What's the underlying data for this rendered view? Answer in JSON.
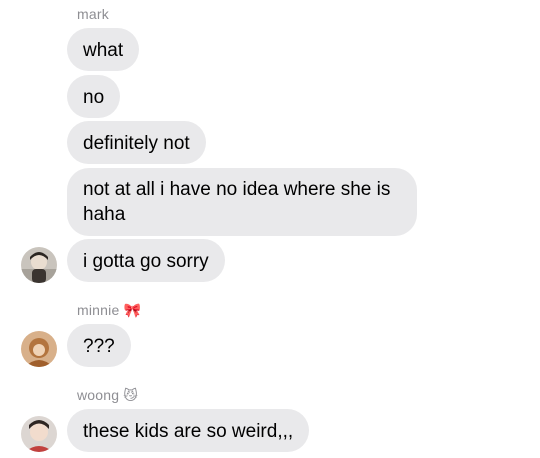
{
  "groups": [
    {
      "sender": "mark",
      "sender_emoji": "",
      "messages": [
        "what",
        "no",
        "definitely not",
        "not at all i have no idea where she is haha",
        "i gotta go sorry"
      ]
    },
    {
      "sender": "minnie",
      "sender_emoji": "🎀",
      "messages": [
        "???"
      ]
    },
    {
      "sender": "woong",
      "sender_emoji": "😼",
      "messages": [
        "these kids are so weird,,,"
      ]
    }
  ],
  "colors": {
    "bubble_incoming": "#e9e9eb",
    "sender_label": "#8e8e93",
    "text": "#000000"
  }
}
